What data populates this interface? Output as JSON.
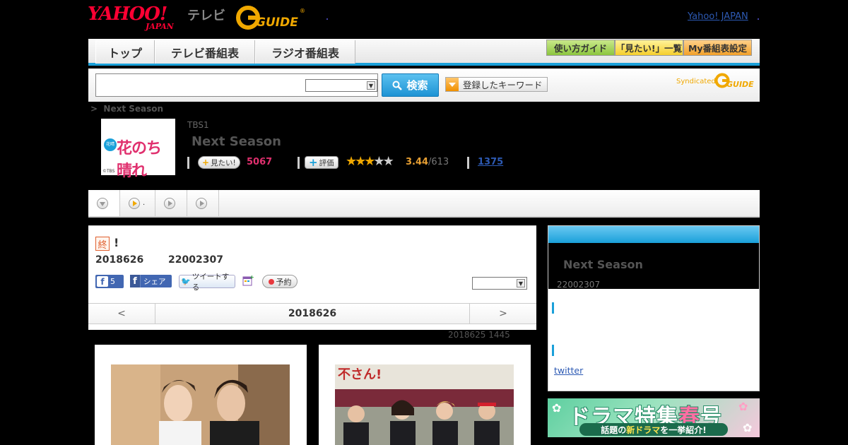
{
  "header": {
    "yahoo_logo_main": "YAHOO!",
    "yahoo_logo_sub": "JAPAN",
    "tv_label": "テレビ",
    "gguide_logo_text": "GUIDE",
    "yahoo_japan_link": "Yahoo! JAPAN"
  },
  "nav": {
    "tabs": [
      {
        "label": "トップ"
      },
      {
        "label": "テレビ番組表"
      },
      {
        "label": "ラジオ番組表"
      }
    ],
    "buttons": [
      {
        "label": "使い方ガイド"
      },
      {
        "label": "「見たい!」一覧"
      },
      {
        "label": "My番組表設定"
      }
    ]
  },
  "search": {
    "placeholder": "",
    "select_value": "",
    "button_label": "検索",
    "keyword_button": "登録したキーワード",
    "syndicated_label": "Syndicated",
    "syndicated_logo": "GUIDE"
  },
  "breadcrumb": {
    "separator": ">",
    "current": "Next Season"
  },
  "program": {
    "thumb_title": "花のち晴れ",
    "thumb_badge": "花晴",
    "thumb_copyright": "©TBS",
    "channel": "TBS1",
    "title": "Next Season",
    "want_label": "見たい!",
    "want_count": "5067",
    "rate_label": "評価",
    "rating": 3.44,
    "rating_text": "3.44",
    "votes_text": "/613",
    "review_count": "1375"
  },
  "tabstrip": {
    "tabs": [
      {
        "label": ""
      },
      {
        "label": "."
      },
      {
        "label": ""
      },
      {
        "label": ""
      }
    ]
  },
  "episode": {
    "end_badge": "終",
    "title_suffix": "!",
    "date": "2018626",
    "time": "22002307",
    "fb_like_count": "5",
    "fb_share_label": "シェア",
    "tweet_label": "ツイートする",
    "reserve_label": "予約",
    "select_value": "",
    "nav_prev": "<",
    "nav_current": "2018626",
    "nav_next": ">",
    "updated": "2018625  1445"
  },
  "side": {
    "title": "Next Season",
    "time": "22002307",
    "twitter_link": "twitter"
  },
  "banner": {
    "line1_a": "ドラマ特集",
    "line1_b": "春",
    "line1_c": "号",
    "line2_a": "話題の",
    "line2_b": "新ドラマ",
    "line2_c": "を一挙紹介!"
  },
  "colors": {
    "accent_blue": "#1aa0d9",
    "brand_red": "#ff0033",
    "gguide_yellow": "#f0a800",
    "want_pink": "#e0306e"
  }
}
